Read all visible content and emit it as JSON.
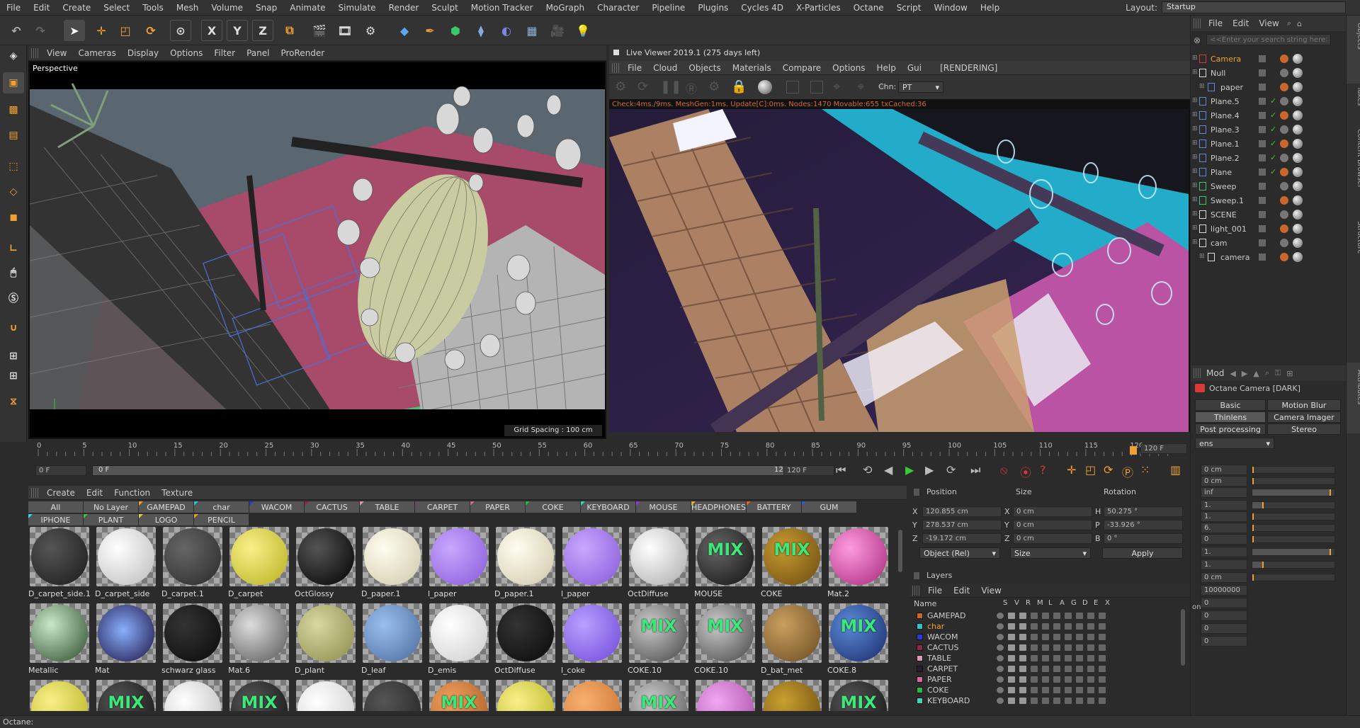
{
  "menubar": {
    "items": [
      "File",
      "Edit",
      "Create",
      "Select",
      "Tools",
      "Mesh",
      "Volume",
      "Snap",
      "Animate",
      "Simulate",
      "Render",
      "Sculpt",
      "Motion Tracker",
      "MoGraph",
      "Character",
      "Pipeline",
      "Plugins",
      "Cycles 4D",
      "X-Particles",
      "Octane",
      "Script",
      "Window",
      "Help"
    ],
    "layout_label": "Layout:",
    "layout_value": "Startup"
  },
  "viewport": {
    "menu": [
      "View",
      "Cameras",
      "Display",
      "Options",
      "Filter",
      "Panel",
      "ProRender"
    ],
    "label": "Perspective",
    "grid_spacing": "Grid Spacing : 100 cm"
  },
  "live_viewer": {
    "title": "Live Viewer 2019.1 (275 days left)",
    "menu": [
      "File",
      "Cloud",
      "Objects",
      "Materials",
      "Compare",
      "Options",
      "Help",
      "Gui"
    ],
    "status": "[RENDERING]",
    "channel_label": "Chn:",
    "channel_value": "PT",
    "stats": "Check:4ms./9ms. MeshGen:1ms. Update[C]:0ms. Nodes:1470 Movable:655 txCached:36"
  },
  "timeline": {
    "ticks": [
      "0",
      "5",
      "10",
      "15",
      "20",
      "25",
      "30",
      "35",
      "40",
      "45",
      "50",
      "55",
      "60",
      "65",
      "70",
      "75",
      "80",
      "85",
      "90",
      "95",
      "100",
      "105",
      "110",
      "115",
      "120"
    ],
    "end_field": "120 F",
    "current_frame": "0 F",
    "range_start": "0 F",
    "range_end": "120 F",
    "range_end2": "120 F"
  },
  "material_manager": {
    "menu": [
      "Create",
      "Edit",
      "Function",
      "Texture"
    ],
    "tags_row1": [
      "All",
      "No Layer",
      "GAMEPAD",
      "char",
      "WACOM",
      "CACTUS",
      "TABLE",
      "CARPET",
      "PAPER",
      "COKE",
      "KEYBOARD",
      "MOUSE",
      "HEADPHONES",
      "BATTERY",
      "GUM"
    ],
    "tags_row2": [
      "IPHONE",
      "PLANT",
      "LOGO",
      "PENCIL"
    ],
    "mix_label": "MIX",
    "row1": [
      "D_carpet_side.1",
      "D_carpet_side",
      "D_carpet.1",
      "D_carpet",
      "OctGlossy",
      "D_paper.1",
      "l_paper",
      "D_paper.1",
      "l_paper",
      "OctDiffuse",
      "MOUSE",
      "COKE",
      "Mat.2"
    ],
    "row2": [
      "Metallic",
      "Mat",
      "schwarz glass",
      "Mat.6",
      "D_plant",
      "D_leaf",
      "D_emis",
      "OctDiffuse",
      "l_coke",
      "COKE.10",
      "COKE.10",
      "D_bat_met",
      "COKE.8"
    ]
  },
  "coordinates": {
    "headers": [
      "Position",
      "Size",
      "Rotation"
    ],
    "axes": [
      "X",
      "Y",
      "Z"
    ],
    "rot_axes": [
      "H",
      "P",
      "B"
    ],
    "position": [
      "120.855 cm",
      "278.537 cm",
      "-19.172 cm"
    ],
    "size": [
      "0 cm",
      "0 cm",
      "0 cm"
    ],
    "rotation": [
      "50.275 °",
      "-33.926 °",
      "0 °"
    ],
    "mode": "Object (Rel)",
    "size_mode": "Size",
    "apply": "Apply"
  },
  "layers": {
    "title": "Layers",
    "menu": [
      "File",
      "Edit",
      "View"
    ],
    "name_header": "Name",
    "col_headers": [
      "S",
      "V",
      "R",
      "M",
      "L",
      "A",
      "G",
      "D",
      "E",
      "X"
    ],
    "rows": [
      {
        "name": "GAMEPAD",
        "color": "#c8682a"
      },
      {
        "name": "char",
        "color": "#2ac8c8"
      },
      {
        "name": "WACOM",
        "color": "#2a3ad8"
      },
      {
        "name": "CACTUS",
        "color": "#8a2a4a"
      },
      {
        "name": "TABLE",
        "color": "#d89ab8"
      },
      {
        "name": "CARPET",
        "color": "#2a1a2a"
      },
      {
        "name": "PAPER",
        "color": "#d86a9a"
      },
      {
        "name": "COKE",
        "color": "#2ab84a"
      },
      {
        "name": "KEYBOARD",
        "color": "#3ad8b8"
      }
    ]
  },
  "object_manager": {
    "menu": [
      "File",
      "Edit",
      "View"
    ],
    "search_placeholder": "<<Enter your search string here>>",
    "objects": [
      {
        "name": "Camera",
        "level": 0,
        "active": true
      },
      {
        "name": "Null",
        "level": 0,
        "active": false
      },
      {
        "name": "paper",
        "level": 1,
        "active": false
      },
      {
        "name": "Plane.5",
        "level": 0,
        "active": false
      },
      {
        "name": "Plane.4",
        "level": 0,
        "active": false
      },
      {
        "name": "Plane.3",
        "level": 0,
        "active": false
      },
      {
        "name": "Plane.1",
        "level": 0,
        "active": false
      },
      {
        "name": "Plane.2",
        "level": 0,
        "active": false
      },
      {
        "name": "Plane",
        "level": 0,
        "active": false
      },
      {
        "name": "Sweep",
        "level": 0,
        "active": false
      },
      {
        "name": "Sweep.1",
        "level": 0,
        "active": false
      },
      {
        "name": "SCENE",
        "level": 0,
        "active": false
      },
      {
        "name": "light_001",
        "level": 0,
        "active": false
      },
      {
        "name": "cam",
        "level": 0,
        "active": false
      },
      {
        "name": "camera",
        "level": 1,
        "active": false
      }
    ]
  },
  "attributes": {
    "mode_label": "Mod",
    "title": "Octane Camera [DARK]",
    "tabs": [
      "Basic",
      "Motion Blur",
      "Thinlens",
      "Camera Imager",
      "Post processing",
      "Stereo"
    ],
    "active_tab": "Thinlens",
    "dropdown": "ens",
    "values": [
      "0 cm",
      "0 cm",
      "inf",
      "1.",
      "1.",
      "6.",
      "0",
      "1.",
      "1.",
      "0 cm",
      "10000000",
      "0",
      "0",
      "0",
      "0"
    ],
    "row_label": "on"
  },
  "right_vertical_tabs": [
    "Objects",
    "Takes",
    "Content Browser",
    "Structure",
    "Attributes"
  ],
  "statusbar": {
    "text": "Octane:"
  }
}
